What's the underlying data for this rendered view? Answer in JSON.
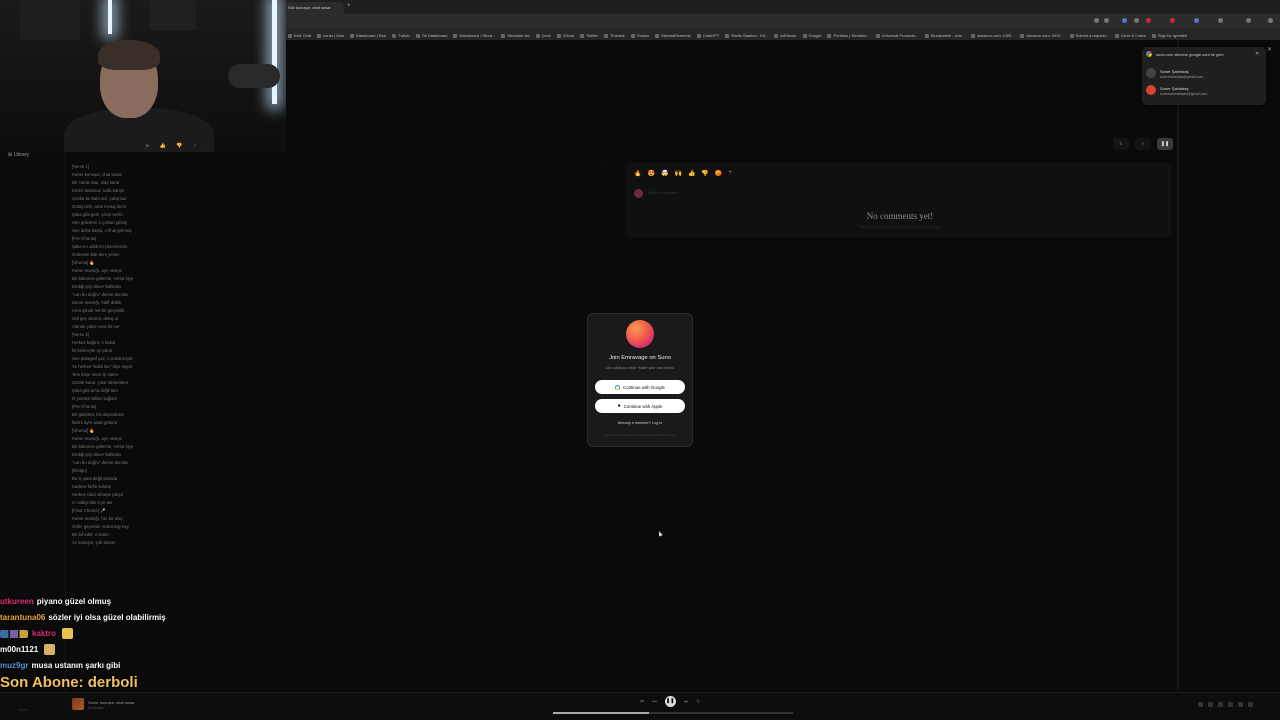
{
  "browser": {
    "active_tab_label": "Söz konuşur, chat susar",
    "new_tab_icon": "plus-icon",
    "bookmarks": [
      "Kick Chat",
      "soner | Kick",
      "Dashboard | Kick",
      "Twitch",
      "Tw Dashboard",
      "Dashboard / Strea...",
      "Streamer Ad",
      "Çevir",
      "iCloud",
      "Twitter",
      "Threads",
      "Oculus",
      "StreamElements",
      "ChatGPT",
      "Radio Stanton - Kit...",
      "AdSense",
      "Google",
      "Portfolio | Shutters...",
      "Universal Products...",
      "Streamable - vide...",
      "Amazon.com: USB...",
      "Amazon.com: NOV...",
      "Submit a request...",
      "Drive & Listen",
      "Sign for Ignetteil"
    ]
  },
  "sidebar": {
    "library_label": "Library"
  },
  "lyrics": [
    "[Verse 1]",
    "Soner konuşur, chat susar",
    "Bir cümle atar, olay kurar",
    "Kimisi anlamaz, kafa karışır",
    "Çünkü bu kafa sizi, çalışmaz",
    "Gülüş belli, ama mesaj derin",
    "Şaka gibi gelir, çıkışı sertin",
    "Sen gülerken o çoktan gitmiş",
    "Sen daha başta, o final görmüş",
    "[Pre-Chorus]",
    "Şaka mı ciddi mi çözemezsin",
    "Gülersen bile ders yersin",
    "[Chorus] 🔥",
    "Soner mantığı, ayrı seviye",
    "Bir bakarsın gülersin, sonra niye",
    "Dediği şey döner kafanda",
    "\"Lan bu doğru\" dersin anında",
    "Soner mantığı, hafif delilik",
    "Ama içinde net bir gerçeklik",
    "Gül geç sanma, detay ol",
    "Altında yatar mow bir ser",
    "[Verse 2]",
    "Herkes bağırır, o bakar",
    "İki kelimeyle işi yakar",
    "Sen paragraf yaz, o nokta koyar",
    "Ve herkes \"haklı lan\" diye sayar",
    "Ters köşe onun işi zaten",
    "Cümle kurar, çıkar labirentten",
    "Şaka gibi ama değil tam",
    "O yüzden lafları sağlam",
    "[Pre-Chorus]",
    "Bir güldürür, bir düşündürür",
    "İkisini aynı anda götürür",
    "[Chorus] 🔥",
    "Soner mantığı, ayrı seviye",
    "Bir bakarsın gülersin, sonra niye",
    "Dediği şey döner kafanda",
    "\"Lan bu doğru\" dersin anında",
    "[Bridge]",
    "Bu iş şaka değil aslında",
    "Sadece farklı anlatış",
    "Herkes ciddi olmaya çalışır",
    "O ciddiyi bile ti ye alır",
    "[Final Chorus] 🎤",
    "Soner mantığı, her bir olay",
    "Güler geçersin, sonra kay kay",
    "Bir laf eder, o kralsı",
    "Az konuşur, çok anlatır"
  ],
  "comments": {
    "emojis": [
      "🔥",
      "😍",
      "🤯",
      "🙌",
      "👍",
      "👎",
      "😡",
      "+"
    ],
    "input_placeholder": "Write a comment...",
    "empty_title": "No comments yet!",
    "empty_subtitle": "Be the first one to share your thoughts on this song"
  },
  "google_popup": {
    "title": "suno.com sitesine google.com ile girin",
    "accounts": [
      {
        "name": "Soner Şahinbaş",
        "email": "sonersahinbas@gmail.com",
        "color": "#444444"
      },
      {
        "name": "Soner Şahinbaş",
        "email": "sonersahinbasan@gmail.com",
        "color": "#d9452f"
      }
    ]
  },
  "modal": {
    "title": "Join Emravage on Suno",
    "subtitle": "Like what you hear? Make your own music.",
    "google_button": "Continue with Google",
    "apple_button": "Continue with Apple",
    "login_link": "Already a member? Log in",
    "terms": "By continuing, you agree to Privacy Policy and Terms of Use"
  },
  "chat": [
    {
      "user": "utkureen",
      "user_color": "#e0297a",
      "message": "piyano güzel olmuş",
      "badges": false,
      "emote": false
    },
    {
      "user": "tarantuna06",
      "user_color": "#e8a53a",
      "message": "sözler iyi olsa güzel olabilirmiş",
      "badges": false,
      "emote": false
    },
    {
      "user": "kaktro",
      "user_color": "#e0297a",
      "message": "",
      "badges": true,
      "emote": true
    },
    {
      "user": "m00n1121",
      "user_color": "#ffffff",
      "message": "",
      "badges": false,
      "emote": true
    },
    {
      "user": "muz9gr",
      "user_color": "#5a8fd6",
      "message": "musa ustanın şarkı gibi",
      "badges": false,
      "emote": false
    }
  ],
  "last_subscriber": "Son Abone: derboli",
  "player": {
    "track_title": "Soner konuşur, chat susar",
    "artist": "Emravage",
    "more_label": "More",
    "progress": 0.4
  }
}
